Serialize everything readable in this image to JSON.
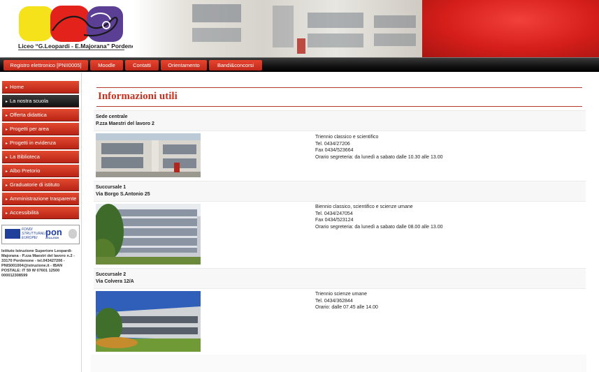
{
  "header": {
    "logo_caption": "Liceo “G.Leopardi - E.Majorana” Pordenone",
    "colors": {
      "yellow": "#f5e21a",
      "red": "#e3231b",
      "purple": "#5a3f95",
      "banner_red": "#d51e1a"
    }
  },
  "nav": {
    "items": [
      "Registro elettronico [PNII0005]",
      "Moodle",
      "Contatti",
      "Orientamento",
      "Bandi&concorsi"
    ]
  },
  "sidebar": {
    "items": [
      "Home",
      "La nostra scuola",
      "Offerta didattica",
      "Progetti per area",
      "Progetti in evidenza",
      "La Biblioteca",
      "Albo Pretorio",
      "Graduatorie di istituto",
      "Amministrazione trasparente",
      "Accessibilità"
    ],
    "active_item": "La nostra scuola",
    "pon_banner": {
      "text": "FONDI STRUTTURALI EUROPEI",
      "logo": "pon",
      "years": "2014-2020"
    },
    "address": "Istituto Istruzione Superiore Leopardi-Majorana - P.zza Maestri del lavoro n.2 - 33170 Pordenone - tel.043427206 - PNIS001004@istruzione.it - IBAN POSTALE: IT 59 W 07601 12500 000012308599"
  },
  "main": {
    "title": "Informazioni utili",
    "sites": [
      {
        "name": "Sede centrale",
        "address": "P.zza Maestri del lavoro 2",
        "info": [
          "Triennio classico e scientifico",
          "Tel. 0434/27206",
          "Fax 0434/523664",
          "Orario segreteria: da lunedì a sabato dalle 10.30 alle 13.00"
        ]
      },
      {
        "name": "Succursale 1",
        "address": "Via Borgo S.Antonio 25",
        "info": [
          "Biennio classico, scientifico e scienze umane",
          "Tel. 0434/247054",
          "Fax 0434/523124",
          "Orario segreteria: da lunedì a sabato dalle 08.00 alle 13.00"
        ]
      },
      {
        "name": "Succursale 2",
        "address": "Via Colvera 12/A",
        "info": [
          "Triennio scienze umane",
          "Tel. 0434/362844",
          "Orario: dalle 07.45 alle 14.00"
        ]
      }
    ]
  },
  "icons": {
    "sidebar_bullet": "arrow-right-icon"
  }
}
